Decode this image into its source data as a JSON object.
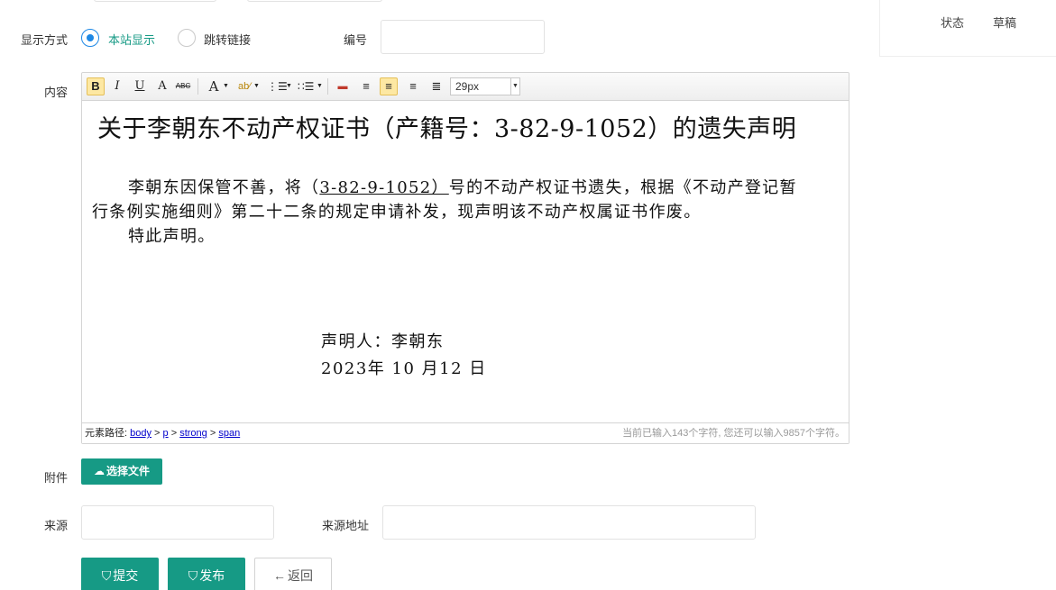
{
  "status": {
    "label": "状态",
    "value": "草稿"
  },
  "display_mode": {
    "label": "显示方式",
    "options": [
      {
        "label": "本站显示",
        "checked": true
      },
      {
        "label": "跳转链接",
        "checked": false
      }
    ]
  },
  "number_field": {
    "label": "编号",
    "value": ""
  },
  "content_field": {
    "label": "内容"
  },
  "toolbar": {
    "bold": "B",
    "italic": "I",
    "underline": "U",
    "font_border": "A",
    "strikethrough": "ABC",
    "font_color": "A",
    "font_size": "29px"
  },
  "document": {
    "title": "关于李朝东不动产权证书（产籍号：3-82-9-1052）的遗失声明",
    "para1_before": "李朝东因保管不善，将（",
    "para1_number": "3-82-9-1052）",
    "para1_after": "号的不动产权证书遗失，根据《不动产登记暂",
    "para1_line2": "行条例实施细则》第二十二条的规定申请补发，现声明该不动产权属证书作废。",
    "para2": "特此声明。",
    "signer": "声明人：李朝东",
    "date": "2023年 10 月12  日"
  },
  "editor_status": {
    "path_label": "元素路径:",
    "path": [
      "body",
      "p",
      "strong",
      "span"
    ],
    "word_count": "当前已输入143个字符, 您还可以输入9857个字符。"
  },
  "attachment": {
    "label": "附件",
    "button": "选择文件"
  },
  "source": {
    "label": "来源",
    "value": "",
    "url_label": "来源地址",
    "url_value": ""
  },
  "actions": {
    "submit": "提交",
    "publish": "发布",
    "back": "返回"
  },
  "colors": {
    "primary": "#169a85",
    "radio_accent": "#1e88e5",
    "active_tool": "#fde8a3"
  }
}
